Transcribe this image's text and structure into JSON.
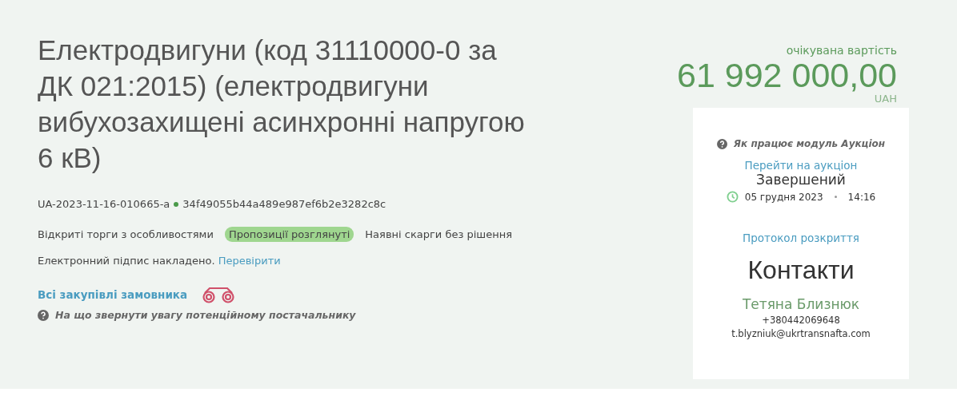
{
  "title": "Електродвигуни (код 31110000-0 за ДК 021:2015) (електродвигуни вибухозахищені асинхронні напругою 6 кВ)",
  "tender_id": "UA-2023-11-16-010665-a",
  "hash": "34f49055b44a489e987ef6b2e3282c8c",
  "tags": [
    {
      "label": "Відкриті торги з особливостями",
      "kind": "plain"
    },
    {
      "label": "Пропозиції розглянуті",
      "kind": "badge"
    },
    {
      "label": "Наявні скарги без рішення",
      "kind": "plain"
    }
  ],
  "signature": {
    "text": "Електронний підпис накладено.",
    "link": "Перевірити"
  },
  "buyer_link": "Всі закупівлі замовника",
  "hint": "На що звернути увагу потенційному постачальнику",
  "price": {
    "label": "очікувана вартість",
    "amount": "61 992 000,00",
    "currency": "UAH"
  },
  "auction": {
    "help": "Як працює модуль Аукціон",
    "link": "Перейти на аукціон",
    "status": "Завершений",
    "date": "05 грудня 2023",
    "time": "14:16"
  },
  "protocol_link": "Протокол розкриття",
  "contacts": {
    "heading": "Контакти",
    "name": "Тетяна Близнюк",
    "phone": "+380442069648",
    "email": "t.blyzniuk@ukrtransnafta.com"
  }
}
